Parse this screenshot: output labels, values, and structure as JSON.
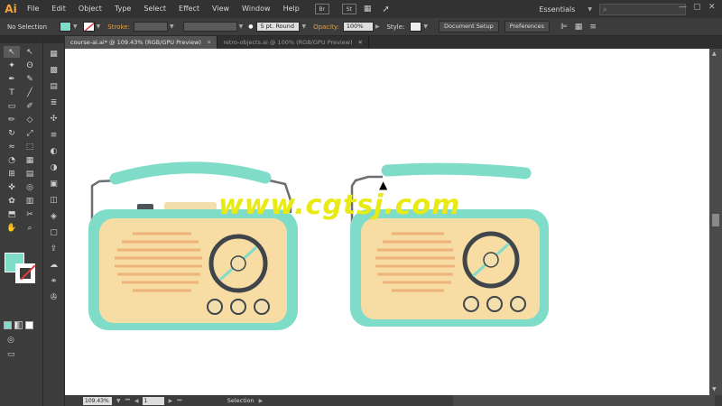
{
  "app": {
    "logo": "Ai",
    "menu": [
      "File",
      "Edit",
      "Object",
      "Type",
      "Select",
      "Effect",
      "View",
      "Window",
      "Help"
    ],
    "bridge_buttons": [
      "Br",
      "St"
    ],
    "workspace": "Essentials",
    "search_placeholder": ""
  },
  "control_bar": {
    "selection_label": "No Selection",
    "stroke_label": "Stroke:",
    "brush_value": "5 pt. Round",
    "opacity_label": "Opacity:",
    "opacity_value": "100%",
    "style_label": "Style:",
    "document_setup": "Document Setup",
    "preferences": "Preferences",
    "fill_color": "#7fdcc9"
  },
  "tabs": [
    {
      "label": "course-ai.ai* @ 109.43% (RGB/GPU Preview)",
      "active": true
    },
    {
      "label": "retro-objects.ai @ 100% (RGB/GPU Preview)",
      "active": false
    }
  ],
  "tools": {
    "names": [
      "selection-tool",
      "direct-selection-tool",
      "magic-wand-tool",
      "lasso-tool",
      "pen-tool",
      "curvature-tool",
      "type-tool",
      "line-tool",
      "rectangle-tool",
      "paintbrush-tool",
      "shaper-tool",
      "eraser-tool",
      "rotate-tool",
      "scale-tool",
      "width-tool",
      "free-transform-tool",
      "shape-builder-tool",
      "perspective-grid-tool",
      "mesh-tool",
      "gradient-tool",
      "eyedropper-tool",
      "blend-tool",
      "symbol-sprayer-tool",
      "column-graph-tool",
      "artboard-tool",
      "slice-tool",
      "hand-tool",
      "zoom-tool"
    ],
    "glyphs": [
      "↖",
      "↖",
      "✦",
      "ʘ",
      "✒",
      "✎",
      "T",
      "╱",
      "▭",
      "✐",
      "✏",
      "◇",
      "↻",
      "⤢",
      "≈",
      "⬚",
      "◔",
      "▦",
      "⊞",
      "▤",
      "✜",
      "◎",
      "✿",
      "▥",
      "⬒",
      "✂",
      "✋",
      "⌕"
    ]
  },
  "status": {
    "zoom": "109.43%",
    "page": "1",
    "text": "Selection"
  },
  "watermark": "www.cgtsj.com",
  "colors": {
    "body_teal": "#7fdcc9",
    "panel_cream": "#f7dca4",
    "stripes_orange": "#eeb37a",
    "dial_dark": "#3f4548",
    "knob": "#f3dfae"
  }
}
